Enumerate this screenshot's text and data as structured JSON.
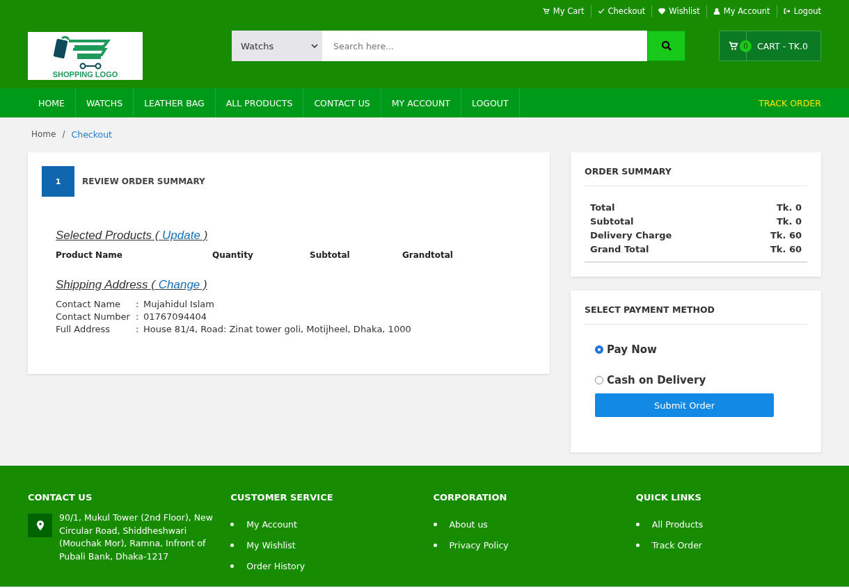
{
  "top_links": [
    {
      "label": "My Cart"
    },
    {
      "label": "Checkout"
    },
    {
      "label": "Wishlist"
    },
    {
      "label": "My Account"
    },
    {
      "label": "Logout"
    }
  ],
  "logo": {
    "text": "SHOPPING LOGO"
  },
  "search": {
    "category": "Watchs",
    "placeholder": "Search here..."
  },
  "cart": {
    "count": "0",
    "label": "CART - TK.0"
  },
  "nav": [
    {
      "label": "HOME"
    },
    {
      "label": "WATCHS"
    },
    {
      "label": "LEATHER BAG"
    },
    {
      "label": "ALL PRODUCTS"
    },
    {
      "label": "CONTACT US"
    },
    {
      "label": "MY ACCOUNT"
    },
    {
      "label": "LOGOUT"
    }
  ],
  "nav_right": "TRACK ORDER",
  "breadcrumb": [
    {
      "label": "Home",
      "selected": false
    },
    {
      "label": "Checkout",
      "selected": true
    }
  ],
  "breadcrumb_separator": "/",
  "step": {
    "number": "1",
    "title": "REVIEW ORDER SUMMARY"
  },
  "products": {
    "heading": "Selected Products ( ",
    "link": "Update",
    "close": " )",
    "columns": [
      "Product Name",
      "Quantity",
      "Subtotal",
      "Grandtotal"
    ]
  },
  "shipping": {
    "heading": "Shipping Address ( ",
    "link": "Change",
    "close": " )",
    "fields": [
      {
        "label": "Contact Name",
        "separator": ":",
        "value": "Mujahidul Islam"
      },
      {
        "label": "Contact Number",
        "separator": ":",
        "value": "01767094404"
      },
      {
        "label": "Full Address",
        "separator": ":",
        "value": "House 81/4, Road: Zinat tower goli, Motijheel, Dhaka, 1000"
      }
    ]
  },
  "order_summary": {
    "title": "ORDER SUMMARY",
    "rows": [
      {
        "label": "Total",
        "value": "Tk. 0"
      },
      {
        "label": "Subtotal",
        "value": "Tk. 0"
      },
      {
        "label": "Delivery Charge",
        "value": "Tk. 60"
      },
      {
        "label": "Grand Total",
        "value": "Tk. 60"
      }
    ]
  },
  "payment": {
    "title": "SELECT PAYMENT METHOD",
    "options": [
      {
        "label": "Pay Now",
        "selected": true
      },
      {
        "label": "Cash on Delivery",
        "selected": false
      }
    ],
    "submit": "Submit Order"
  },
  "footer": {
    "contact": {
      "title": "CONTACT US",
      "address": "90/1, Mukul Tower (2nd Floor), New Circular Road, Shiddheshwari (Mouchak Mor), Ramna, Infront of Pubali Bank, Dhaka-1217"
    },
    "columns": [
      {
        "title": "CUSTOMER SERVICE",
        "links": [
          "My Account",
          "My Wishlist",
          "Order History"
        ]
      },
      {
        "title": "CORPORATION",
        "links": [
          "About us",
          "Privacy Policy"
        ]
      },
      {
        "title": "QUICK LINKS",
        "links": [
          "All Products",
          "Track Order"
        ]
      }
    ]
  }
}
